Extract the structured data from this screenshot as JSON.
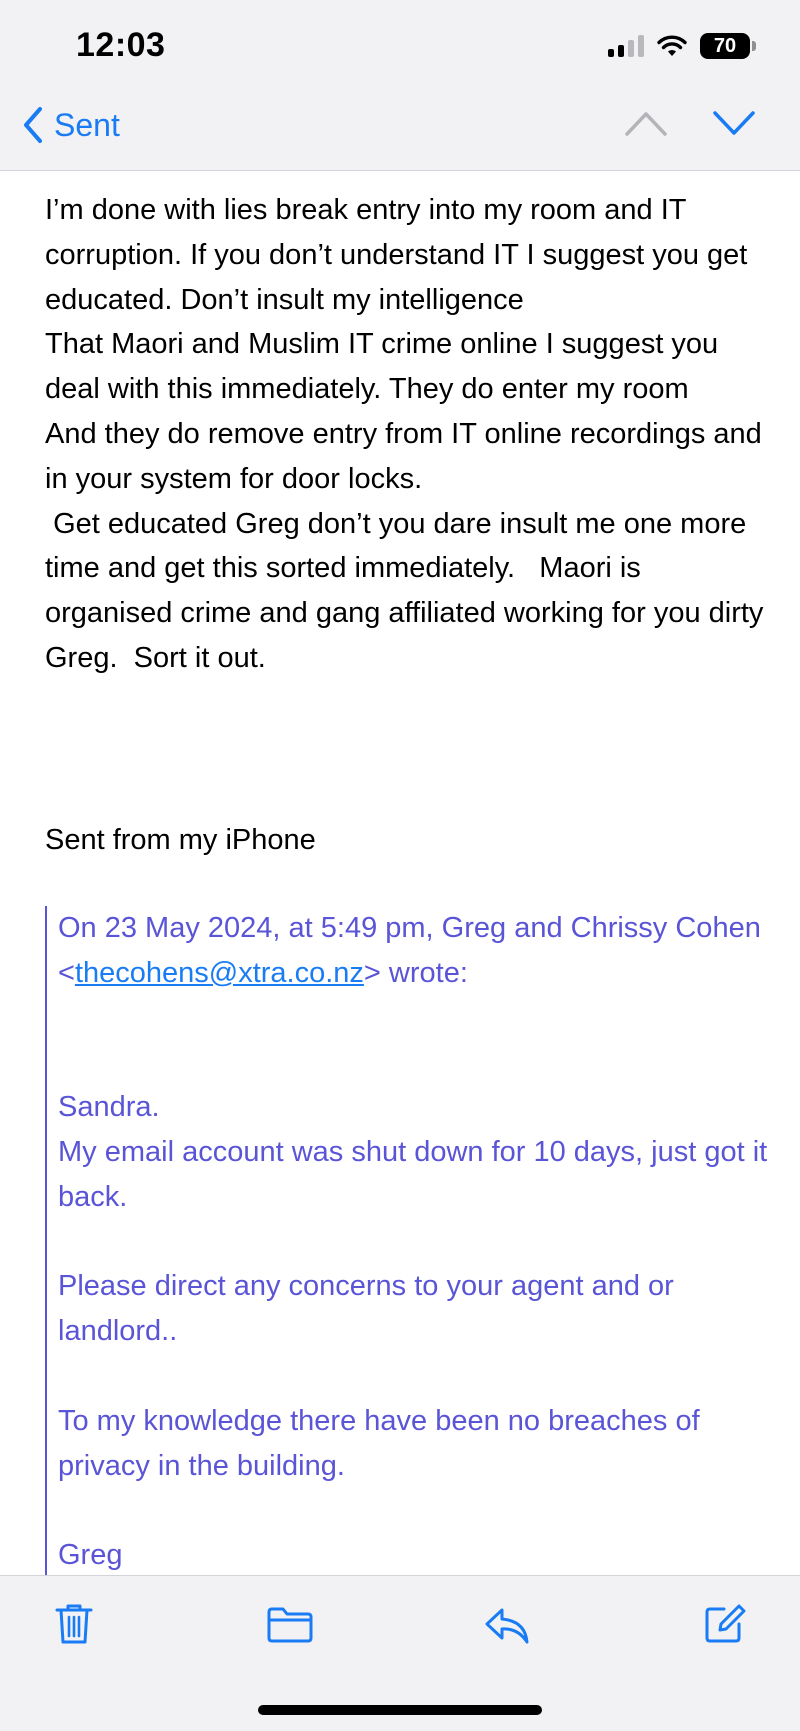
{
  "status_bar": {
    "time": "12:03",
    "battery_level": "70",
    "battery_fraction": 0.7,
    "signal_bars_active": 2,
    "icons": [
      "cellular-signal-icon",
      "wifi-icon",
      "battery-icon"
    ]
  },
  "nav": {
    "back_label": "Sent",
    "icons": [
      "chevron-left-icon",
      "chevron-up-icon",
      "chevron-down-icon"
    ],
    "accent_color": "#1a7cf5"
  },
  "message": {
    "body": "I’m done with lies break entry into my room and IT corruption. If you don’t understand IT I suggest you get educated. Don’t insult my intelligence\nThat Maori and Muslim IT crime online I suggest you deal with this immediately. They do enter my room\nAnd they do remove entry from IT online recordings and in your system for door locks.\n Get educated Greg don’t you dare insult me one more time and get this sorted immediately.   Maori is organised crime and gang affiliated working for you dirty Greg.  Sort it out.",
    "signature": "Sent from my iPhone",
    "quoted": {
      "header_prefix": "On 23 May 2024, at 5:49 pm, Greg and Chrissy Cohen <",
      "email_link": "thecohens@xtra.co.nz",
      "header_suffix": "> wrote:",
      "greeting": "Sandra.",
      "para1": "My email account was shut down for 10 days, just got it back.",
      "para2": "Please direct any concerns to your agent and or landlord..",
      "para3": "To my knowledge there have been no breaches of privacy in the building.",
      "sign_off": "Greg",
      "quote_color": "#5a54d6"
    }
  },
  "toolbar": {
    "icons": [
      "trash-icon",
      "folder-icon",
      "reply-icon",
      "compose-icon"
    ]
  }
}
